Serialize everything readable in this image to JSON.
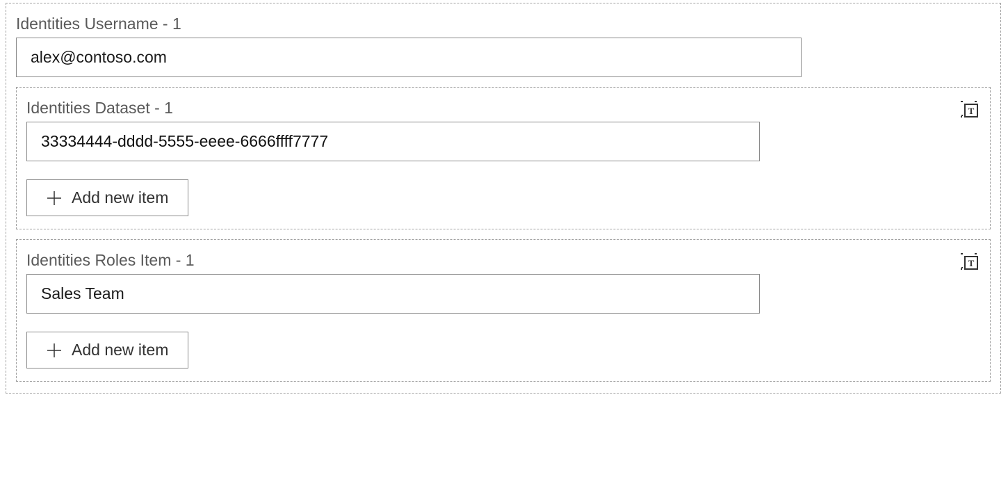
{
  "sections": {
    "username": {
      "label": "Identities Username - 1",
      "value": "alex@contoso.com"
    },
    "dataset": {
      "label": "Identities Dataset - 1",
      "value": "33334444-dddd-5555-eeee-6666ffff7777",
      "addLabel": "Add new item"
    },
    "roles": {
      "label": "Identities Roles Item - 1",
      "value": "Sales Team",
      "addLabel": "Add new item"
    }
  }
}
